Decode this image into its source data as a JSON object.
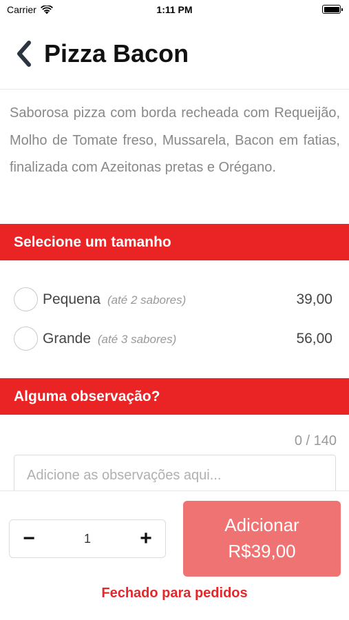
{
  "status_bar": {
    "carrier": "Carrier",
    "time": "1:11 PM"
  },
  "header": {
    "title": "Pizza Bacon"
  },
  "product": {
    "description": "Saborosa pizza com borda recheada com Requeijão, Molho de Tomate freso, Mussarela, Bacon em fatias, finalizada com Azeitonas pretas e Orégano."
  },
  "sizes": {
    "section_title": "Selecione um tamanho",
    "options": [
      {
        "name": "Pequena",
        "note": "(até 2 sabores)",
        "price": "39,00"
      },
      {
        "name": "Grande",
        "note": "(até 3 sabores)",
        "price": "56,00"
      }
    ]
  },
  "notes": {
    "section_title": "Alguma observação?",
    "counter": "0 / 140",
    "placeholder": "Adicione as observações aqui..."
  },
  "footer": {
    "quantity": "1",
    "minus_label": "−",
    "plus_label": "+",
    "add_label": "Adicionar",
    "add_price": "R$39,00",
    "closed_message": "Fechado para pedidos"
  },
  "colors": {
    "accent": "#ea2325",
    "button": "#f07373",
    "closed": "#e5262a"
  }
}
